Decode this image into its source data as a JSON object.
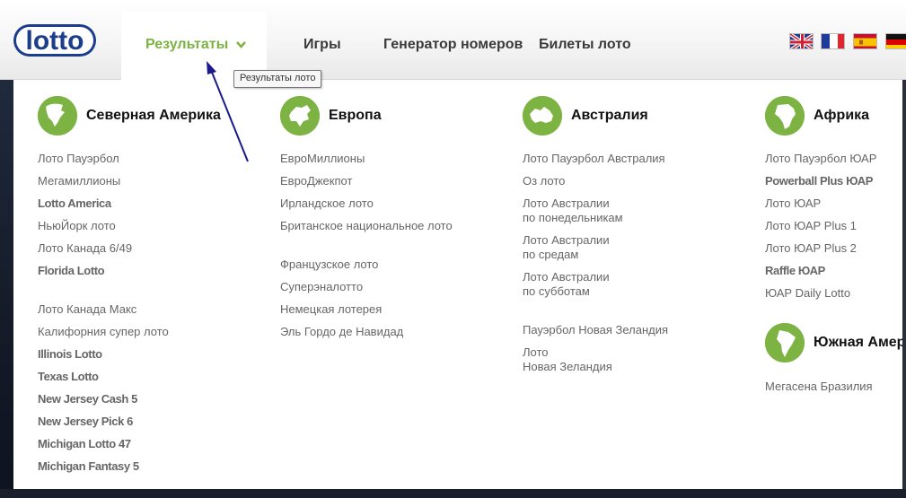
{
  "header": {
    "logo_text": "lotto",
    "nav": [
      {
        "label": "Результаты",
        "active": true
      },
      {
        "label": "Игры"
      },
      {
        "label": "Генератор номеров"
      },
      {
        "label": "Билеты лото"
      }
    ],
    "flags": [
      "gb-flag-icon",
      "fr-flag-icon",
      "es-flag-icon",
      "de-flag-icon"
    ]
  },
  "tooltip": "Результаты лото",
  "regions": [
    {
      "title": "Северная Америка",
      "groups": [
        [
          "Лото Пауэрбол",
          "Мегамиллионы",
          "Lotto America",
          "НьюЙорк лото",
          "Лото Канада 6/49",
          "Florida Lotto"
        ],
        [
          "Лото Канада Макс",
          "Калифорния супер лото",
          "Illinois Lotto",
          "Texas Lotto",
          "New Jersey Cash 5",
          "New Jersey Pick 6",
          "Michigan Lotto 47",
          "Michigan Fantasy 5"
        ]
      ]
    },
    {
      "title": "Европа",
      "groups": [
        [
          "ЕвроМиллионы",
          "ЕвроДжекпот",
          "Ирландское лото",
          "Британское национальное лото"
        ],
        [
          "Французское лото",
          "Суперэналотто",
          "Немецкая лотерея",
          "Эль Гордо де Навидад"
        ]
      ]
    },
    {
      "title": "Австралия",
      "groups": [
        [
          "Лото Пауэрбол Австралия",
          "Оз лото",
          "Лото Австралии\nпо понедельникам",
          "Лото Австралии\nпо средам",
          "Лото Австралии\nпо субботам"
        ],
        [
          "Пауэрбол Новая Зеландия",
          "Лото\nНовая Зеландия"
        ]
      ]
    },
    {
      "title": "Африка",
      "groups": [
        [
          "Лото Пауэрбол ЮАР",
          "Powerball Plus ЮАР",
          "Лото ЮАР",
          "Лото ЮАР Plus 1",
          "Лото ЮАР Plus 2",
          "Raffle ЮАР",
          "ЮАР Daily Lotto"
        ]
      ]
    },
    {
      "title": "Южная Амер",
      "groups": [
        [
          "Мегасена Бразилия"
        ]
      ]
    }
  ],
  "colors": {
    "accent": "#7cb342",
    "text": "#666666",
    "logo_blue": "#1c3d8c"
  }
}
